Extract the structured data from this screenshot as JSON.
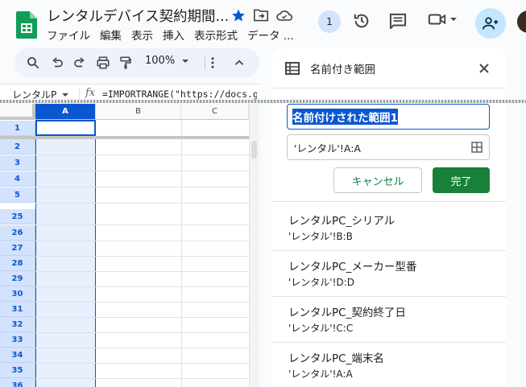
{
  "doc": {
    "title": "レンタルデバイス契約期間...",
    "menu": [
      "ファイル",
      "編集",
      "表示",
      "挿入",
      "表示形式",
      "データ ..."
    ]
  },
  "header": {
    "presence_count": "1"
  },
  "toolbar": {
    "zoom": "100%"
  },
  "formula_bar": {
    "name_box": "レンタルP",
    "fx_label": "fx",
    "formula": "=IMPORTRANGE(\"https://docs.g"
  },
  "grid": {
    "columns": [
      "A",
      "B",
      "C"
    ],
    "rows_top": [
      "1",
      "2",
      "3",
      "4",
      "5"
    ],
    "rows_bottom": [
      "25",
      "26",
      "27",
      "28",
      "29",
      "30",
      "31",
      "32",
      "33",
      "34",
      "35",
      "36"
    ]
  },
  "panel": {
    "title": "名前付き範囲",
    "name_input_value": "名前付けされた範囲1",
    "range_input_value": "'レンタル'!A:A",
    "cancel_label": "キャンセル",
    "done_label": "完了",
    "ranges": [
      {
        "name": "レンタルPC_シリアル",
        "ref": "'レンタル'!B:B"
      },
      {
        "name": "レンタルPC_メーカー型番",
        "ref": "'レンタル'!D:D"
      },
      {
        "name": "レンタルPC_契約終了日",
        "ref": "'レンタル'!C:C"
      },
      {
        "name": "レンタルPC_端末名",
        "ref": "'レンタル'!A:A"
      }
    ]
  },
  "colors": {
    "accent_blue": "#0b57d0",
    "done_green": "#188038",
    "selection_fill": "#e8f0fe",
    "sheets_green": "#0f9d58"
  }
}
